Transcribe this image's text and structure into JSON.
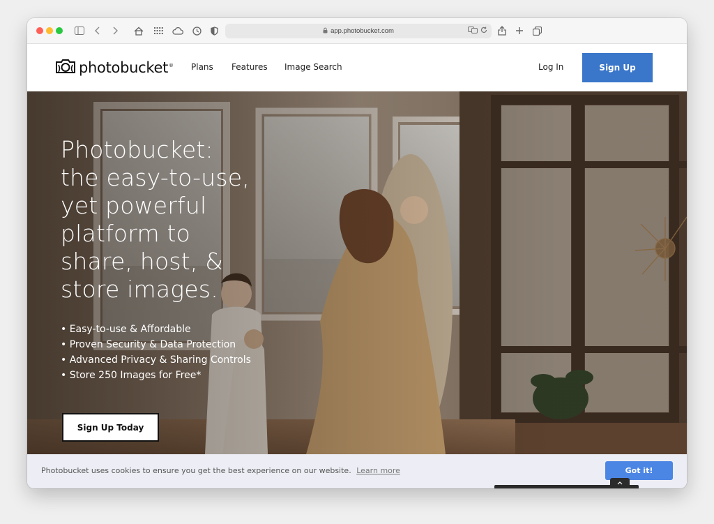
{
  "browser": {
    "url": "app.photobucket.com"
  },
  "header": {
    "logo_text": "photobucket",
    "logo_mark": "®",
    "nav": [
      {
        "label": "Plans"
      },
      {
        "label": "Features"
      },
      {
        "label": "Image Search"
      }
    ],
    "login_label": "Log In",
    "signup_label": "Sign Up",
    "signup_color": "#3a76c9"
  },
  "hero": {
    "title_lines": [
      "Photobucket:",
      "the easy-to-use,",
      "yet powerful",
      "platform to",
      "share, host, &",
      "store images."
    ],
    "bullets": [
      "• Easy-to-use & Affordable",
      "• Proven Security & Data Protection",
      "• Advanced Privacy & Sharing Controls",
      "• Store 250 Images for Free*"
    ],
    "cta_label": "Sign Up Today"
  },
  "cookie": {
    "message": "Photobucket uses cookies to ensure you get the best experience on our website.",
    "link_label": "Learn more",
    "accept_label": "Got it!",
    "accept_color": "#4c86e4"
  }
}
